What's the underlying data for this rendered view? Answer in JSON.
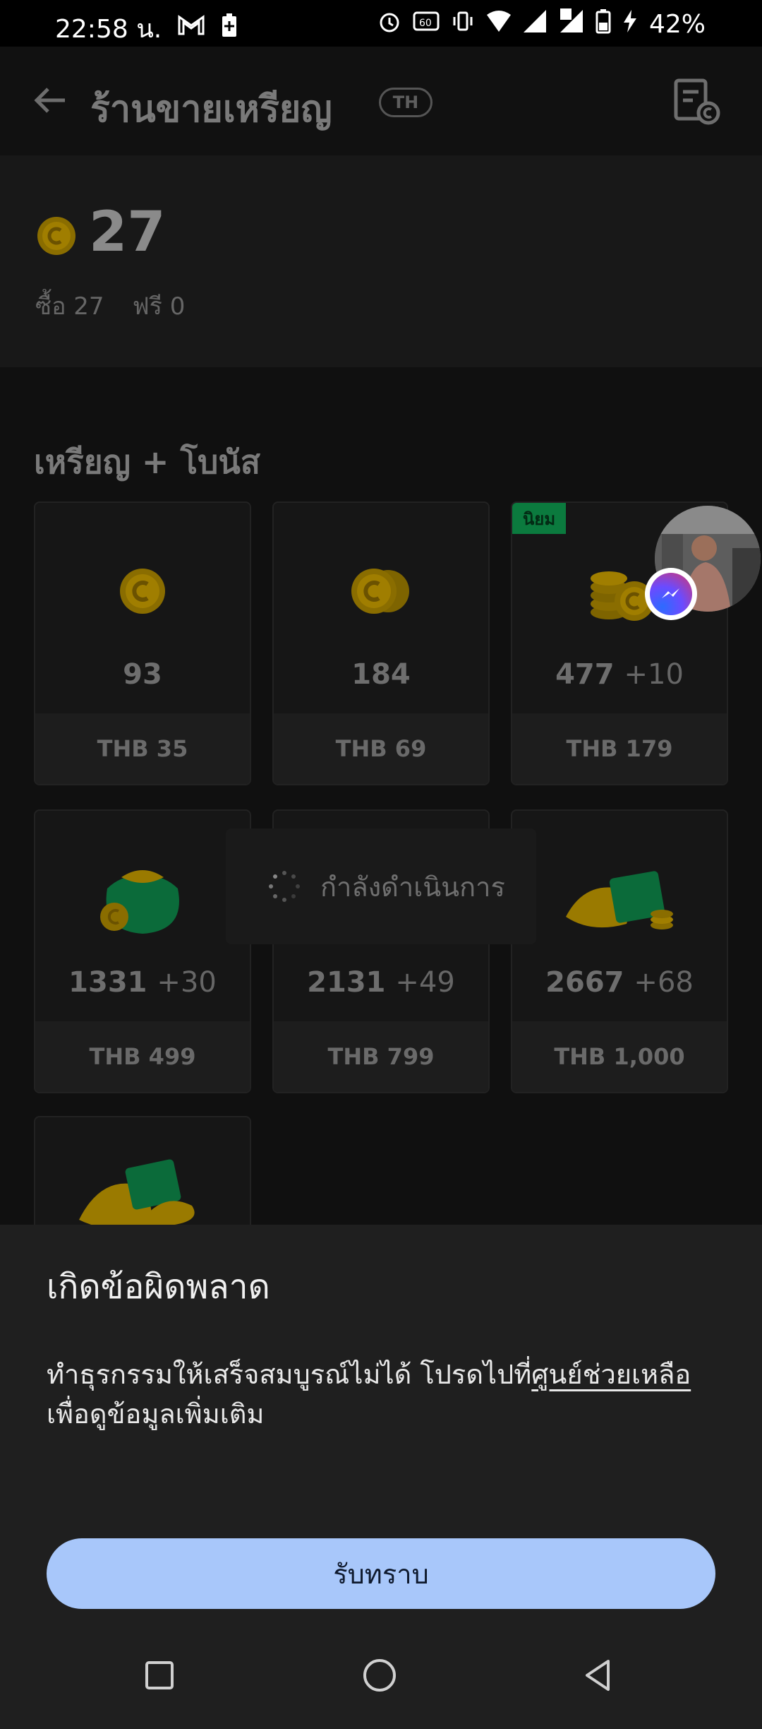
{
  "status_bar": {
    "time": "22:58 น.",
    "battery": "42%",
    "signal_badge": "2"
  },
  "header": {
    "title": "ร้านขายเหรียญ",
    "region": "TH"
  },
  "balance": {
    "amount": "27",
    "bought": "ซื้อ 27",
    "free": "ฟรี 0"
  },
  "section": {
    "title": "เหรียญ + โบนัส"
  },
  "packages": [
    {
      "amount": "93",
      "bonus": "",
      "price": "THB 35"
    },
    {
      "amount": "184",
      "bonus": "",
      "price": "THB 69"
    },
    {
      "amount": "477",
      "bonus": "+10",
      "price": "THB 179",
      "tag": "นิยม"
    },
    {
      "amount": "1331",
      "bonus": "+30",
      "price": "THB 499"
    },
    {
      "amount": "2131",
      "bonus": "+49",
      "price": "THB 799"
    },
    {
      "amount": "2667",
      "bonus": "+68",
      "price": "THB 1,000"
    }
  ],
  "loading": {
    "text": "กำลังดำเนินการ"
  },
  "error_sheet": {
    "title": "เกิดข้อผิดพลาด",
    "message_before_link": "ทำธุรกรรมให้เสร็จสมบูรณ์ไม่ได้ โปรดไปที่",
    "link": "ศูนย์ช่วยเหลือ",
    "message_after_link": "เพื่อดูข้อมูลเพิ่มเติม",
    "ok_label": "รับทราบ"
  },
  "colors": {
    "button_bg": "#a8c7fa",
    "popular_tag": "#0b7a3e",
    "coin_gold": "#c9a300"
  }
}
